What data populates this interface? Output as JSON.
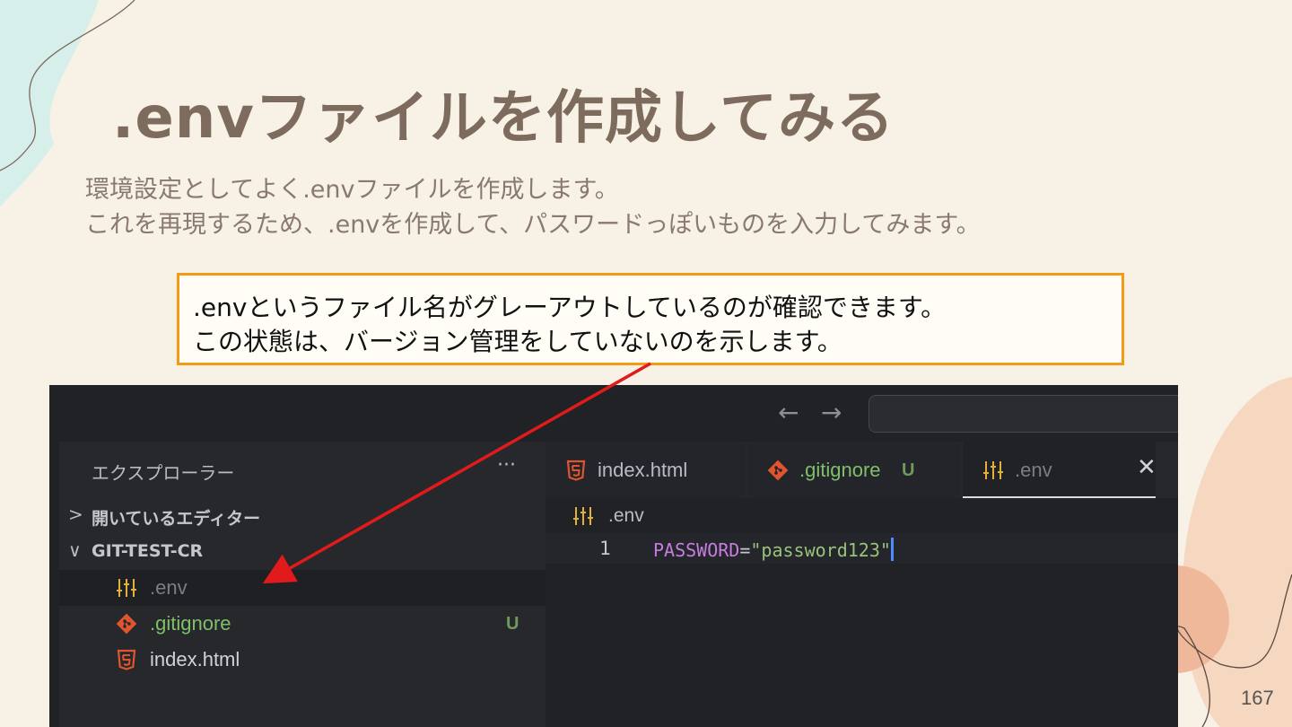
{
  "slide": {
    "title": ".envファイルを作成してみる",
    "subtitle_lines": [
      "環境設定としてよく.envファイルを作成します。",
      "これを再現するため、.envを作成して、パスワードっぽいものを入力してみます。"
    ],
    "callout_lines": [
      ".envというファイル名がグレーアウトしているのが確認できます。",
      "この状態は、バージョン管理をしていないのを示します。"
    ],
    "page_number": "167",
    "colors": {
      "background": "#f8f1e6",
      "title": "#7d6b5d",
      "callout_border": "#f39a16",
      "arrow": "#e11b1b"
    }
  },
  "editor": {
    "titlebar": {
      "back_icon": "arrow-left-icon",
      "forward_icon": "arrow-right-icon"
    },
    "sidebar": {
      "title": "エクスプローラー",
      "more_icon": "ellipsis-icon",
      "sections": [
        {
          "label": "開いているエディター",
          "expanded": false
        },
        {
          "label": "GIT-TEST-CR",
          "expanded": true
        }
      ],
      "files": [
        {
          "name": ".env",
          "icon": "settings-sliders-icon",
          "color": "#7a7d84",
          "badge": ""
        },
        {
          "name": ".gitignore",
          "icon": "git-icon",
          "color": "#7fbf6a",
          "badge": "U"
        },
        {
          "name": "index.html",
          "icon": "html5-icon",
          "color": "#cfd2d8",
          "badge": ""
        }
      ]
    },
    "tabs": [
      {
        "label": "index.html",
        "icon": "html5-icon",
        "badge": ""
      },
      {
        "label": ".gitignore",
        "icon": "git-icon",
        "badge": "U"
      },
      {
        "label": ".env",
        "icon": "settings-sliders-icon",
        "badge": "",
        "active": true,
        "close_icon": "close-icon"
      }
    ],
    "breadcrumb": {
      "label": ".env",
      "icon": "settings-sliders-icon"
    },
    "code": {
      "line_number": "1",
      "key": "PASSWORD",
      "operator": "=",
      "value": "\"password123\""
    }
  }
}
